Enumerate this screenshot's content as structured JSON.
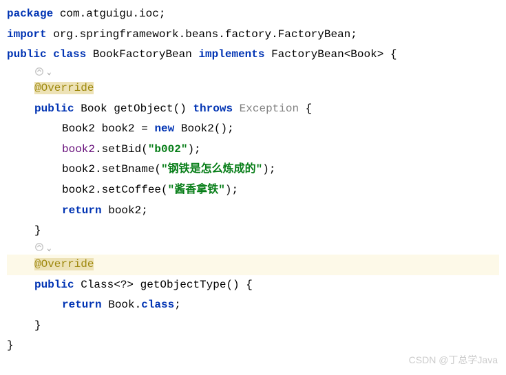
{
  "line1": {
    "kw": "package",
    "pkg": " com.atguigu.ioc;"
  },
  "line2": {
    "kw": "import",
    "pkg": " org.springframework.beans.factory.FactoryBean;"
  },
  "line3": {
    "kw1": "public class",
    "cls": " BookFactoryBean ",
    "kw2": "implements",
    "impl": " FactoryBean<Book> {"
  },
  "line4": {
    "ann": "@Override"
  },
  "line5": {
    "kw1": "public",
    "type": " Book ",
    "method": "getObject",
    "paren": "() ",
    "kw2": "throws",
    "exc": " Exception",
    "brace": " {"
  },
  "line6": {
    "type": "Book2 ",
    "var": "book2",
    "eq": " = ",
    "kw": "new",
    "ctor": " Book2();"
  },
  "line7": {
    "var": "book2",
    "call": ".setBid(",
    "str": "\"b002\"",
    "end": ");"
  },
  "line8": {
    "var": "book2",
    "call": ".setBname(",
    "str": "\"钢铁是怎么炼成的\"",
    "end": ");"
  },
  "line9": {
    "var": "book2",
    "call": ".setCoffee(",
    "str": "\"酱香拿铁\"",
    "end": ");"
  },
  "line10": {
    "kw": "return",
    "var": " book2;"
  },
  "line11": {
    "brace": "}"
  },
  "line12": {
    "ann": "@Override"
  },
  "line13": {
    "kw1": "public",
    "type": " Class<?> ",
    "method": "getObjectType",
    "paren": "() {"
  },
  "line14": {
    "kw": "return",
    "cls": " Book.",
    "field": "class",
    "end": ";"
  },
  "line15": {
    "brace": "}"
  },
  "line16": {
    "brace": "}"
  },
  "watermark": "CSDN @丁总学Java"
}
